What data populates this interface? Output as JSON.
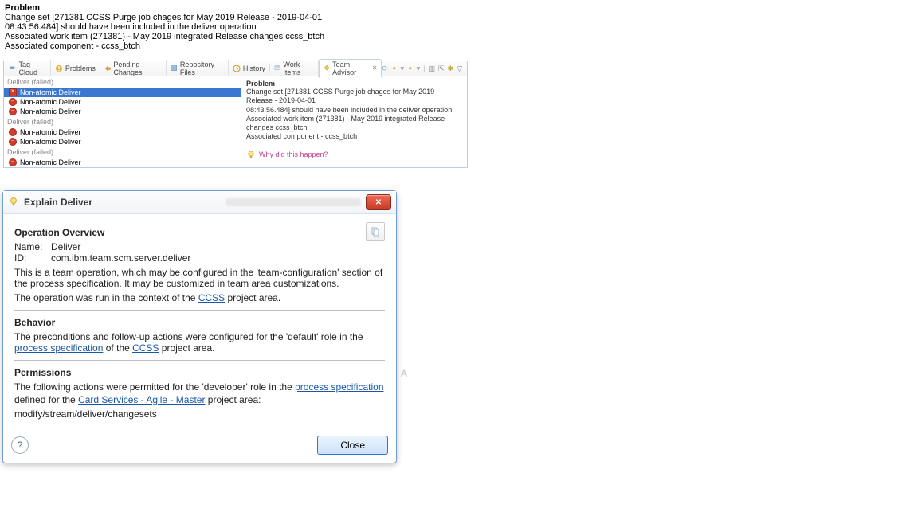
{
  "header": {
    "title": "Problem",
    "lines": [
      "Change set [271381 CCSS Purge job chages for May 2019 Release - 2019-04-01",
      "08:43:56.484] should have been included in the deliver operation",
      "Associated work item (271381) - May 2019 integrated Release changes ccss_btch",
      "Associated component - ccss_btch"
    ]
  },
  "tabs": [
    {
      "label": "Tag Cloud",
      "icon": "tag-icon"
    },
    {
      "label": "Problems",
      "icon": "problems-icon"
    },
    {
      "label": "Pending Changes",
      "icon": "changes-icon"
    },
    {
      "label": "Repository Files",
      "icon": "repo-icon"
    },
    {
      "label": "History",
      "icon": "history-icon"
    },
    {
      "label": "Work Items",
      "icon": "workitems-icon"
    },
    {
      "label": "Team Advisor",
      "icon": "advisor-icon",
      "active": true
    }
  ],
  "left_panel": {
    "groups": [
      {
        "title": "Deliver (failed)",
        "items": [
          {
            "label": "Non-atomic Deliver",
            "icon": "error-x",
            "selected": true
          },
          {
            "label": "Non-atomic Deliver",
            "icon": "error-dot"
          },
          {
            "label": "Non-atomic Deliver",
            "icon": "error-dot"
          }
        ]
      },
      {
        "title": "Deliver (failed)",
        "items": [
          {
            "label": "Non-atomic Deliver",
            "icon": "error-dot"
          },
          {
            "label": "Non-atomic Deliver",
            "icon": "error-dot"
          }
        ]
      },
      {
        "title": "Deliver (failed)",
        "items": [
          {
            "label": "Non-atomic Deliver",
            "icon": "error-dot"
          }
        ]
      }
    ]
  },
  "right_panel": {
    "title": "Problem",
    "lines": [
      "Change set [271381 CCSS Purge job chages for May 2019 Release - 2019-04-01",
      "08:43:56.484] should have been included in the deliver operation",
      "Associated work item (271381) - May 2019 integrated Release changes ccss_btch",
      "Associated component - ccss_btch"
    ],
    "why_link": "Why did this happen?"
  },
  "dialog": {
    "title": "Explain Deliver",
    "close_label": "X",
    "overview": {
      "heading": "Operation Overview",
      "name_label": "Name:",
      "name_value": "Deliver",
      "id_label": "ID:",
      "id_value": "com.ibm.team.scm.server.deliver",
      "desc1_pre": "This is a team operation, which may be configured in the 'team-configuration' section of the process specification. It may be customized in team area customizations.",
      "context_pre": "The operation was run in the context of the ",
      "context_link": "CCSS",
      "context_post": " project area."
    },
    "behavior": {
      "heading": "Behavior",
      "line_pre": "The preconditions and follow-up actions were configured for the 'default' role in the ",
      "ps_link": "process specification",
      "mid": " of the ",
      "ccss_link": "CCSS",
      "post": " project area."
    },
    "permissions": {
      "heading": "Permissions",
      "line_pre": "The following actions were permitted for the 'developer' role in the ",
      "ps_link": "process specification",
      "def_pre": "defined for the ",
      "def_link": "Card Services - Agile - Master",
      "def_post": " project area:",
      "perm_path": "modify/stream/deliver/changesets"
    },
    "close_btn": "Close"
  }
}
